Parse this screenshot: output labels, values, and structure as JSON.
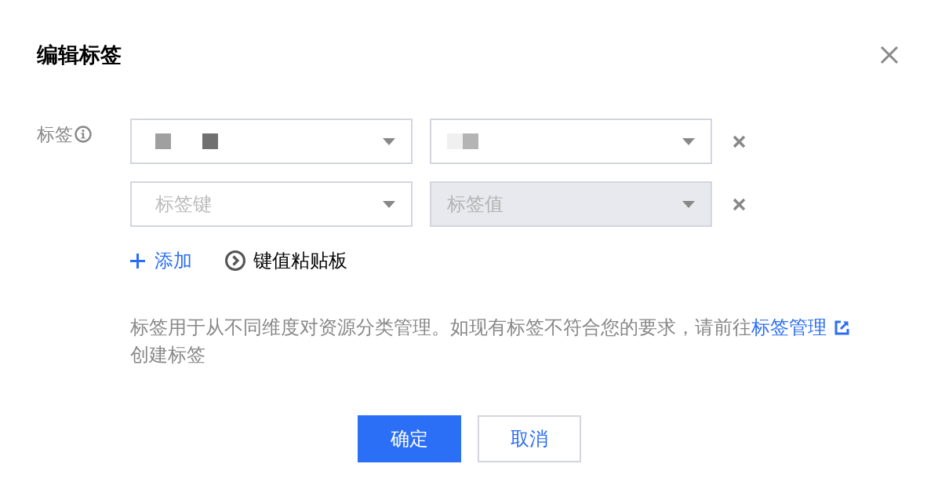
{
  "dialog": {
    "title": "编辑标签"
  },
  "form": {
    "label": "标签",
    "tag_rows": [
      {
        "key": {
          "kind": "redacted",
          "disabled": false,
          "blocks": [
            {
              "color": "#a0a0a0"
            },
            {
              "color": "#707070"
            }
          ]
        },
        "value": {
          "kind": "redacted",
          "disabled": false,
          "blocks": [
            {
              "color": "#f0f0f0"
            },
            {
              "color": "#b4b4b4"
            }
          ]
        }
      },
      {
        "key": {
          "kind": "placeholder",
          "disabled": false,
          "placeholder": "标签键"
        },
        "value": {
          "kind": "placeholder",
          "disabled": true,
          "placeholder": "标签值"
        }
      }
    ],
    "add_link": "添加",
    "clipboard_button": "键值粘贴板",
    "description": {
      "text": "标签用于从不同维度对资源分类管理。如现有标签不符合您的要求，请前往",
      "link": "标签管理",
      "text_after": "创建标签"
    }
  },
  "buttons": [
    {
      "label": "确定",
      "kind": "primary"
    },
    {
      "label": "取消",
      "kind": "secondary"
    }
  ]
}
